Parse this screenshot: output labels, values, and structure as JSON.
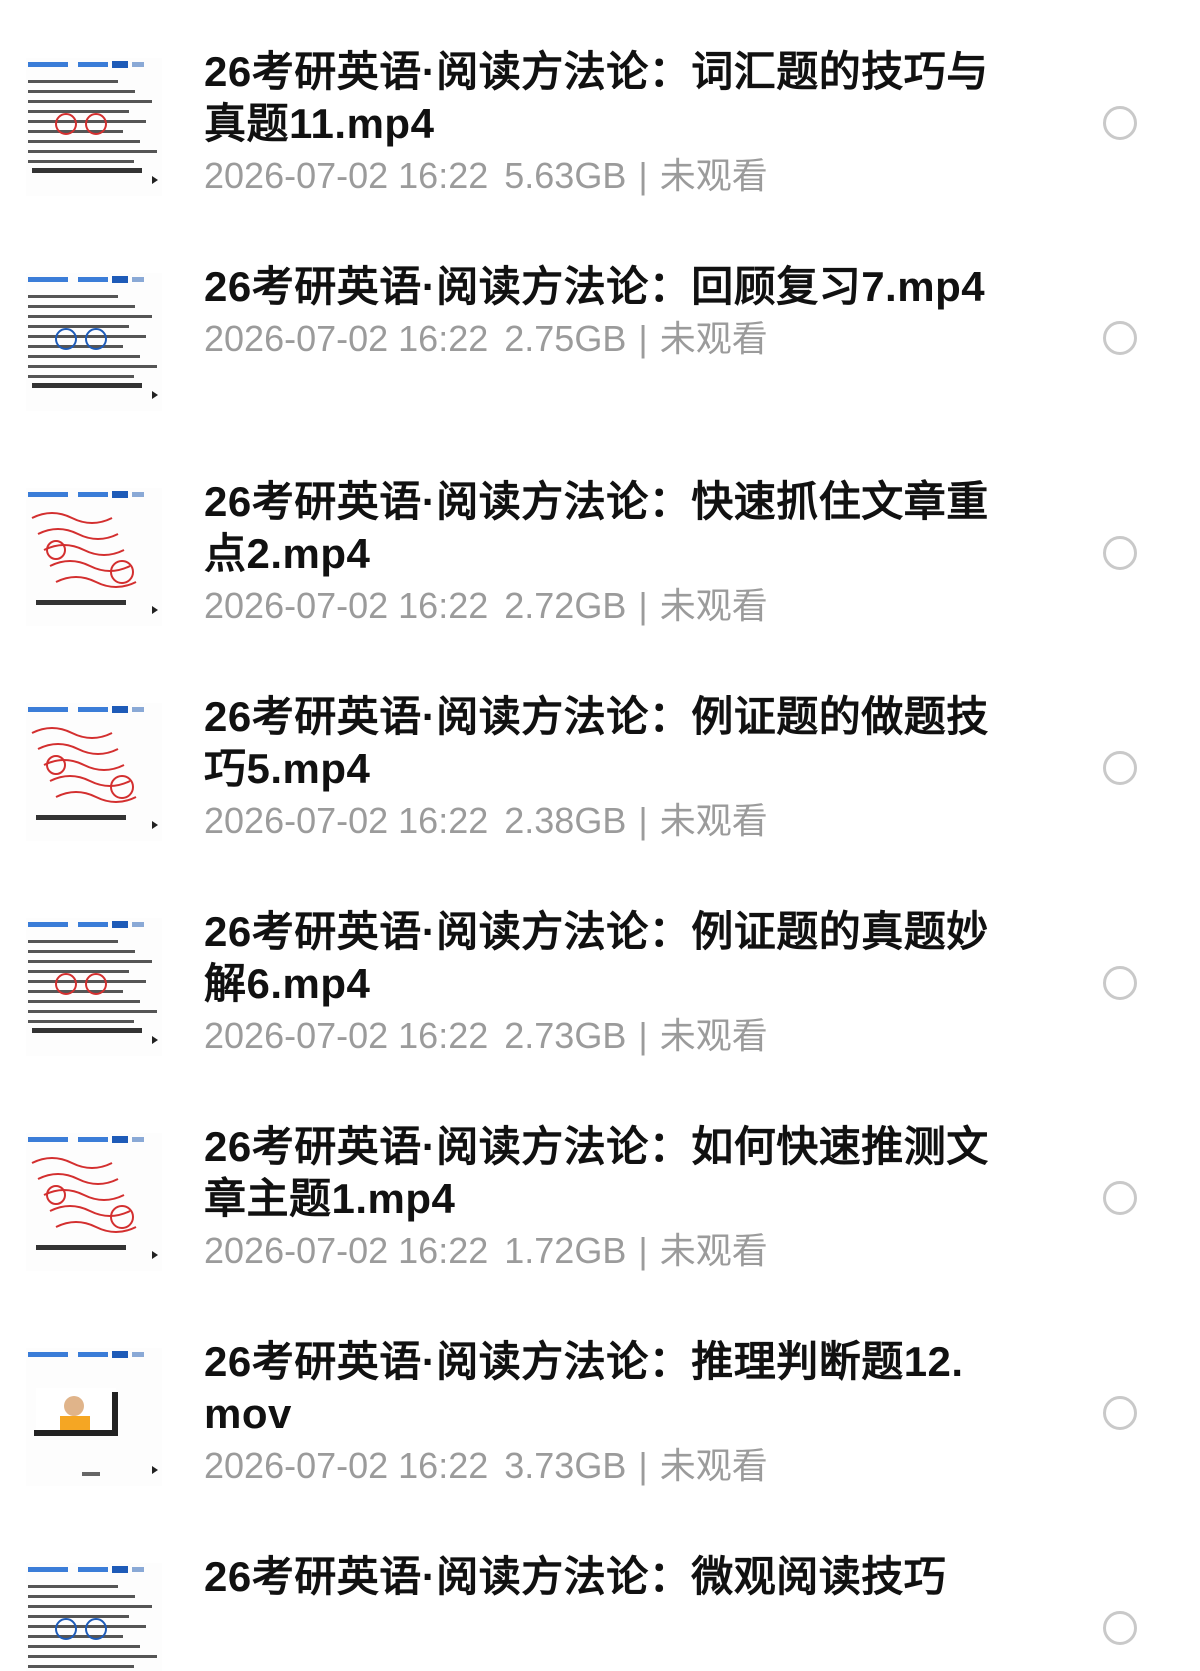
{
  "items": [
    {
      "title": "26考研英语·阅读方法论：词汇题的技巧与真题11.mp4",
      "date": "2026-07-02 16:22",
      "size": "5.63GB",
      "separator": "|",
      "status": "未观看",
      "thumb": {
        "kind": "text-slide",
        "accent": "#d32f2f"
      }
    },
    {
      "title": "26考研英语·阅读方法论：回顾复习7.mp4",
      "date": "2026-07-02 16:22",
      "size": "2.75GB",
      "separator": "|",
      "status": "未观看",
      "thumb": {
        "kind": "text-slide",
        "accent": "#1e5bb8"
      }
    },
    {
      "title": "26考研英语·阅读方法论：快速抓住文章重点2.mp4",
      "date": "2026-07-02 16:22",
      "size": "2.72GB",
      "separator": "|",
      "status": "未观看",
      "thumb": {
        "kind": "handwriting",
        "accent": "#d32f2f"
      }
    },
    {
      "title": "26考研英语·阅读方法论：例证题的做题技巧5.mp4",
      "date": "2026-07-02 16:22",
      "size": "2.38GB",
      "separator": "|",
      "status": "未观看",
      "thumb": {
        "kind": "handwriting",
        "accent": "#d32f2f"
      }
    },
    {
      "title": "26考研英语·阅读方法论：例证题的真题妙解6.mp4",
      "date": "2026-07-02 16:22",
      "size": "2.73GB",
      "separator": "|",
      "status": "未观看",
      "thumb": {
        "kind": "text-slide",
        "accent": "#d32f2f"
      }
    },
    {
      "title": "26考研英语·阅读方法论：如何快速推测文章主题1.mp4",
      "date": "2026-07-02 16:22",
      "size": "1.72GB",
      "separator": "|",
      "status": "未观看",
      "thumb": {
        "kind": "handwriting",
        "accent": "#d32f2f"
      }
    },
    {
      "title": "26考研英语·阅读方法论：推理判断题12.mov",
      "date": "2026-07-02 16:22",
      "size": "3.73GB",
      "separator": "|",
      "status": "未观看",
      "thumb": {
        "kind": "presenter",
        "accent": "#d32f2f"
      }
    },
    {
      "title": "26考研英语·阅读方法论：微观阅读技巧",
      "date": "",
      "size": "",
      "separator": "",
      "status": "",
      "thumb": {
        "kind": "text-slide",
        "accent": "#1e5bb8"
      }
    }
  ]
}
